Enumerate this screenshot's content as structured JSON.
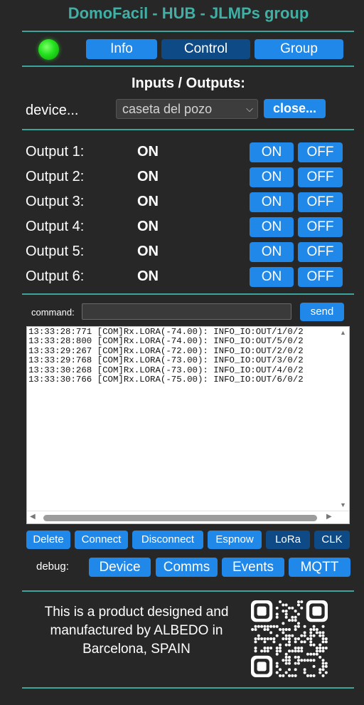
{
  "header": {
    "title": "DomoFacil - HUB - JLMPs group"
  },
  "status": {
    "led_color": "#22e01c"
  },
  "tabs": [
    {
      "label": "Info",
      "active": false
    },
    {
      "label": "Control",
      "active": true
    },
    {
      "label": "Group",
      "active": false
    }
  ],
  "io": {
    "title": "Inputs / Outputs:",
    "device_label": "device...",
    "device_selected": "caseta del pozo",
    "close_label": "close..."
  },
  "outputs": [
    {
      "label": "Output 1:",
      "state": "ON",
      "on_label": "ON",
      "off_label": "OFF"
    },
    {
      "label": "Output 2:",
      "state": "ON",
      "on_label": "ON",
      "off_label": "OFF"
    },
    {
      "label": "Output 3:",
      "state": "ON",
      "on_label": "ON",
      "off_label": "OFF"
    },
    {
      "label": "Output 4:",
      "state": "ON",
      "on_label": "ON",
      "off_label": "OFF"
    },
    {
      "label": "Output 5:",
      "state": "ON",
      "on_label": "ON",
      "off_label": "OFF"
    },
    {
      "label": "Output 6:",
      "state": "ON",
      "on_label": "ON",
      "off_label": "OFF"
    }
  ],
  "command": {
    "label": "command:",
    "value": "",
    "send_label": "send"
  },
  "log": {
    "lines": [
      "13:33:28:771 [COM]Rx.LORA(-74.00): INFO_IO:OUT/1/0/2",
      "13:33:28:800 [COM]Rx.LORA(-74.00): INFO_IO:OUT/5/0/2",
      "13:33:29:267 [COM]Rx.LORA(-72.00): INFO_IO:OUT/2/0/2",
      "13:33:29:768 [COM]Rx.LORA(-73.00): INFO_IO:OUT/3/0/2",
      "13:33:30:268 [COM]Rx.LORA(-73.00): INFO_IO:OUT/4/0/2",
      "13:33:30:766 [COM]Rx.LORA(-75.00): INFO_IO:OUT/6/0/2"
    ]
  },
  "actions": {
    "delete": "Delete",
    "connect": "Connect",
    "disconnect": "Disconnect",
    "espnow": "Espnow",
    "lora": "LoRa",
    "clk": "CLK"
  },
  "debug": {
    "label": "debug:",
    "device": "Device",
    "comms": "Comms",
    "events": "Events",
    "mqtt": "MQTT"
  },
  "footer": {
    "text": "This is a product designed and manufactured by ALBEDO in Barcelona, SPAIN"
  },
  "colors": {
    "background": "#272727",
    "accent": "#3aa59b",
    "button": "#1f88e8",
    "button_active": "#0d4a86"
  }
}
